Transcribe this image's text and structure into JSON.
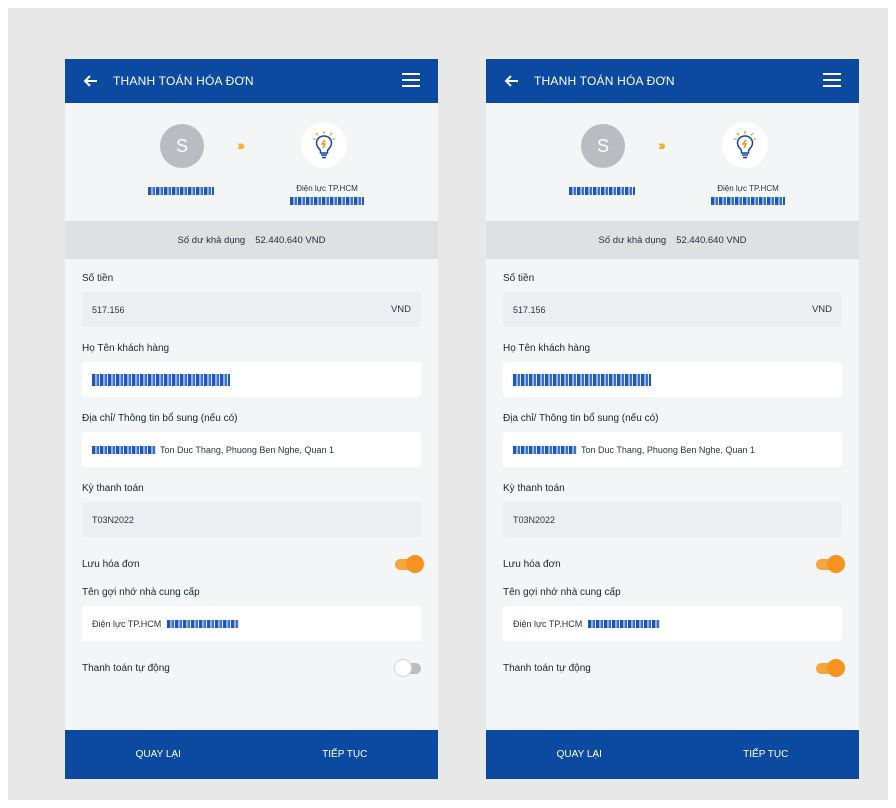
{
  "screens": [
    {
      "header": {
        "title": "THANH TOÁN HÓA ĐƠN"
      },
      "transfer": {
        "avatar_letter": "S",
        "provider_name": "Điện lực TP.HCM"
      },
      "balance": {
        "label": "Số dư khả dụng",
        "value": "52.440.640 VND"
      },
      "amount": {
        "label": "Số tiền",
        "value": "517.156",
        "unit": "VND"
      },
      "customer": {
        "label": "Họ Tên khách hàng"
      },
      "address": {
        "label": "Địa chỉ/ Thông tin bổ sung (nếu có)",
        "value": "Ton Duc Thang, Phuong Ben Nghe, Quan 1"
      },
      "period": {
        "label": "Kỳ thanh toán",
        "value": "T03N2022"
      },
      "save_bill": {
        "label": "Lưu hóa đơn",
        "on": true
      },
      "nickname": {
        "label": "Tên gợi nhớ nhà cung cấp",
        "value": "Điện lực TP.HCM"
      },
      "auto_pay": {
        "label": "Thanh toán tự động",
        "on": false
      },
      "footer": {
        "back_label": "QUAY LẠI",
        "next_label": "TIẾP TỤC"
      }
    },
    {
      "header": {
        "title": "THANH TOÁN HÓA ĐƠN"
      },
      "transfer": {
        "avatar_letter": "S",
        "provider_name": "Điện lực TP.HCM"
      },
      "balance": {
        "label": "Số dư khả dụng",
        "value": "52.440.640 VND"
      },
      "amount": {
        "label": "Số tiền",
        "value": "517.156",
        "unit": "VND"
      },
      "customer": {
        "label": "Họ Tên khách hàng"
      },
      "address": {
        "label": "Địa chỉ/ Thông tin bổ sung (nếu có)",
        "value": "Ton Duc Thang, Phuong Ben Nghe, Quan 1"
      },
      "period": {
        "label": "Kỳ thanh toán",
        "value": "T03N2022"
      },
      "save_bill": {
        "label": "Lưu hóa đơn",
        "on": true
      },
      "nickname": {
        "label": "Tên gợi nhớ nhà cung cấp",
        "value": "Điện lực TP.HCM"
      },
      "auto_pay": {
        "label": "Thanh toán tự động",
        "on": true
      },
      "footer": {
        "back_label": "QUAY LẠI",
        "next_label": "TIẾP TỤC"
      }
    }
  ],
  "colors": {
    "brand": "#0b4aa0",
    "toggle_on": "#f6921e",
    "accent_arrows": "#f0b323"
  }
}
